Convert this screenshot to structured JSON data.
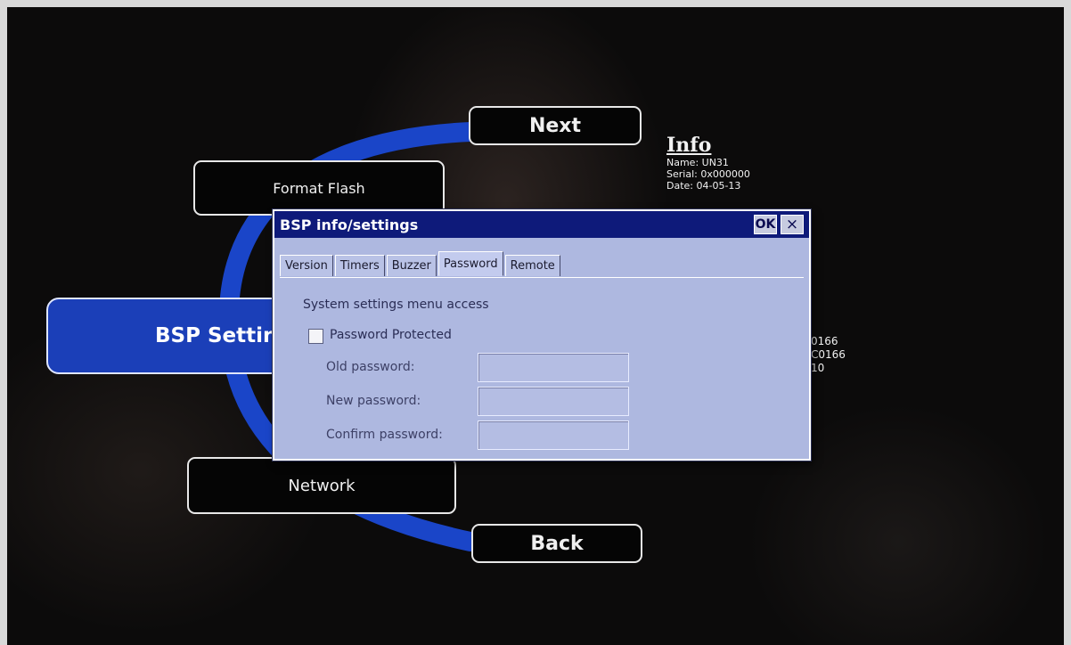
{
  "menu": {
    "next_label": "Next",
    "back_label": "Back",
    "format_flash_label": "Format Flash",
    "network_label": "Network",
    "bsp_settings_label": "BSP Settings"
  },
  "info": {
    "title": "Info",
    "name_line": "Name:  UN31",
    "serial_line": "Serial:  0x000000",
    "date_line": "Date:  04-05-13",
    "partial_lines": [
      "0166",
      "C0166",
      "10"
    ]
  },
  "dialog": {
    "title": "BSP info/settings",
    "ok_label": "OK",
    "close_label": "×",
    "tabs": [
      "Version",
      "Timers",
      "Buzzer",
      "Password",
      "Remote"
    ],
    "active_tab": "Password",
    "section_label": "System settings menu access",
    "password_protected_label": "Password Protected",
    "password_protected_checked": false,
    "old_password_label": "Old password:",
    "new_password_label": "New password:",
    "confirm_password_label": "Confirm password:",
    "old_password_value": "",
    "new_password_value": "",
    "confirm_password_value": ""
  },
  "colors": {
    "accent_blue": "#1b3fb8",
    "title_bar": "#0e1a7a",
    "dialog_bg": "#aeb8e0"
  }
}
